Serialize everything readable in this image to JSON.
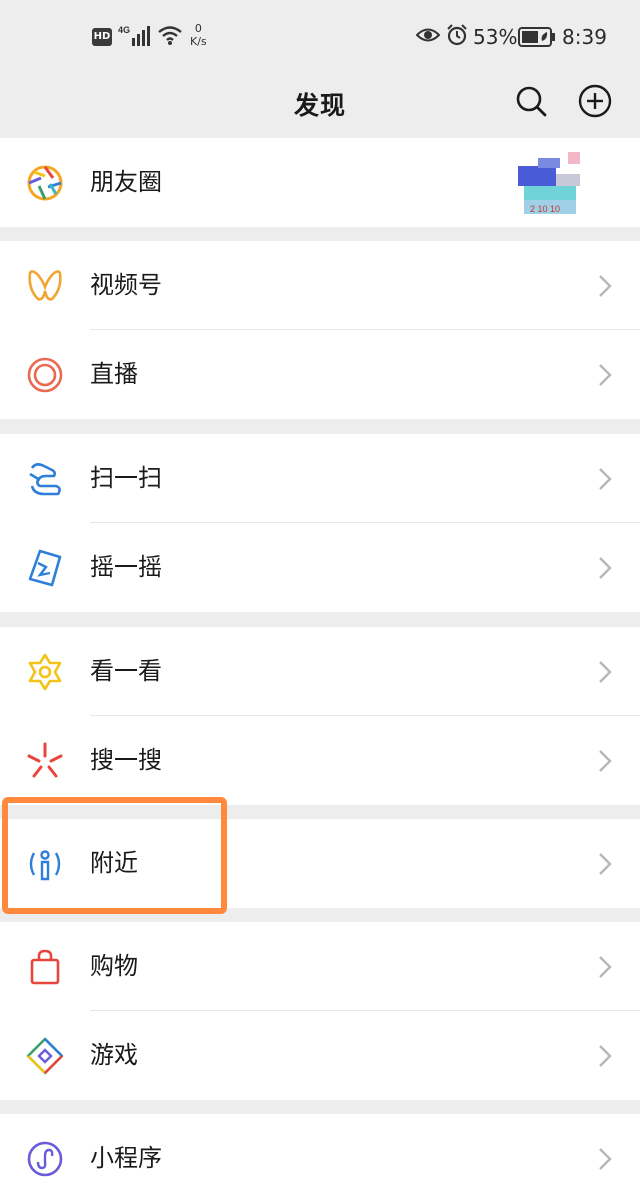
{
  "status_bar": {
    "hd": "HD",
    "network": "4G",
    "speed_value": "0",
    "speed_unit": "K/s",
    "battery": "53%",
    "time": "8:39"
  },
  "header": {
    "title": "发现",
    "search_icon": "search-icon",
    "add_icon": "plus-circle-icon"
  },
  "groups": [
    {
      "items": [
        {
          "label": "朋友圈",
          "icon": "moments-aperture-icon",
          "color": "#f5a623"
        }
      ]
    },
    {
      "items": [
        {
          "label": "视频号",
          "icon": "channels-butterfly-icon",
          "color": "#f0a630"
        },
        {
          "label": "直播",
          "icon": "live-target-icon",
          "color": "#e86a4f"
        }
      ]
    },
    {
      "items": [
        {
          "label": "扫一扫",
          "icon": "scan-icon",
          "color": "#2f7fd8"
        },
        {
          "label": "摇一摇",
          "icon": "shake-phone-icon",
          "color": "#2f7fd8"
        }
      ]
    },
    {
      "items": [
        {
          "label": "看一看",
          "icon": "top-stories-icon",
          "color": "#f3c316"
        },
        {
          "label": "搜一搜",
          "icon": "search-sparkle-icon",
          "color": "#e8453c"
        }
      ]
    },
    {
      "items": [
        {
          "label": "附近",
          "icon": "nearby-person-icon",
          "color": "#2f7fd8"
        }
      ]
    },
    {
      "items": [
        {
          "label": "购物",
          "icon": "shopping-bag-icon",
          "color": "#e8453c"
        },
        {
          "label": "游戏",
          "icon": "game-diamond-icon",
          "color": "#3aa06a"
        }
      ]
    },
    {
      "items": [
        {
          "label": "小程序",
          "icon": "mini-program-icon",
          "color": "#6a5cd8"
        }
      ]
    }
  ],
  "highlight_color": "#ff8a3d"
}
